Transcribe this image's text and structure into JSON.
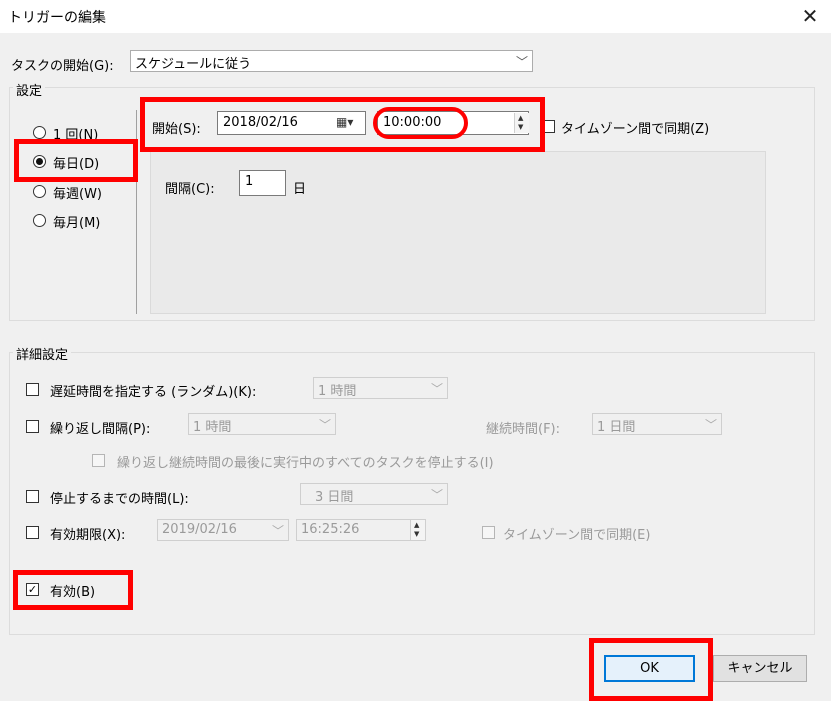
{
  "window": {
    "title": "トリガーの編集",
    "close_glyph": "✕"
  },
  "task_start": {
    "label": "タスクの開始(G):",
    "value": "スケジュールに従う"
  },
  "settings": {
    "title": "設定",
    "radios": [
      {
        "label": "1 回(N)",
        "checked": false
      },
      {
        "label": "毎日(D)",
        "checked": true
      },
      {
        "label": "毎週(W)",
        "checked": false
      },
      {
        "label": "毎月(M)",
        "checked": false
      }
    ],
    "start_label": "開始(S):",
    "start_date": "2018/02/16",
    "start_time": "10:00:00",
    "sync_tz_label": "タイムゾーン間で同期(Z)",
    "interval_label": "間隔(C):",
    "interval_value": "1",
    "interval_unit": "日"
  },
  "advanced": {
    "title": "詳細設定",
    "delay_label": "遅延時間を指定する (ランダム)(K):",
    "delay_value": "1 時間",
    "repeat_label": "繰り返し間隔(P):",
    "repeat_value": "1 時間",
    "duration_label": "継続時間(F):",
    "duration_value": "1 日間",
    "stop_all_label": "繰り返し継続時間の最後に実行中のすべてのタスクを停止する(I)",
    "stop_after_label": "停止するまでの時間(L):",
    "stop_after_value": "3 日間",
    "expire_label": "有効期限(X):",
    "expire_date": "2019/02/16",
    "expire_time": "16:25:26",
    "expire_sync_label": "タイムゾーン間で同期(E)",
    "enabled_label": "有効(B)",
    "enabled_checked": true
  },
  "buttons": {
    "ok": "OK",
    "cancel": "キャンセル"
  },
  "highlight_color": "#ff0000",
  "accent_color": "#0078d7"
}
